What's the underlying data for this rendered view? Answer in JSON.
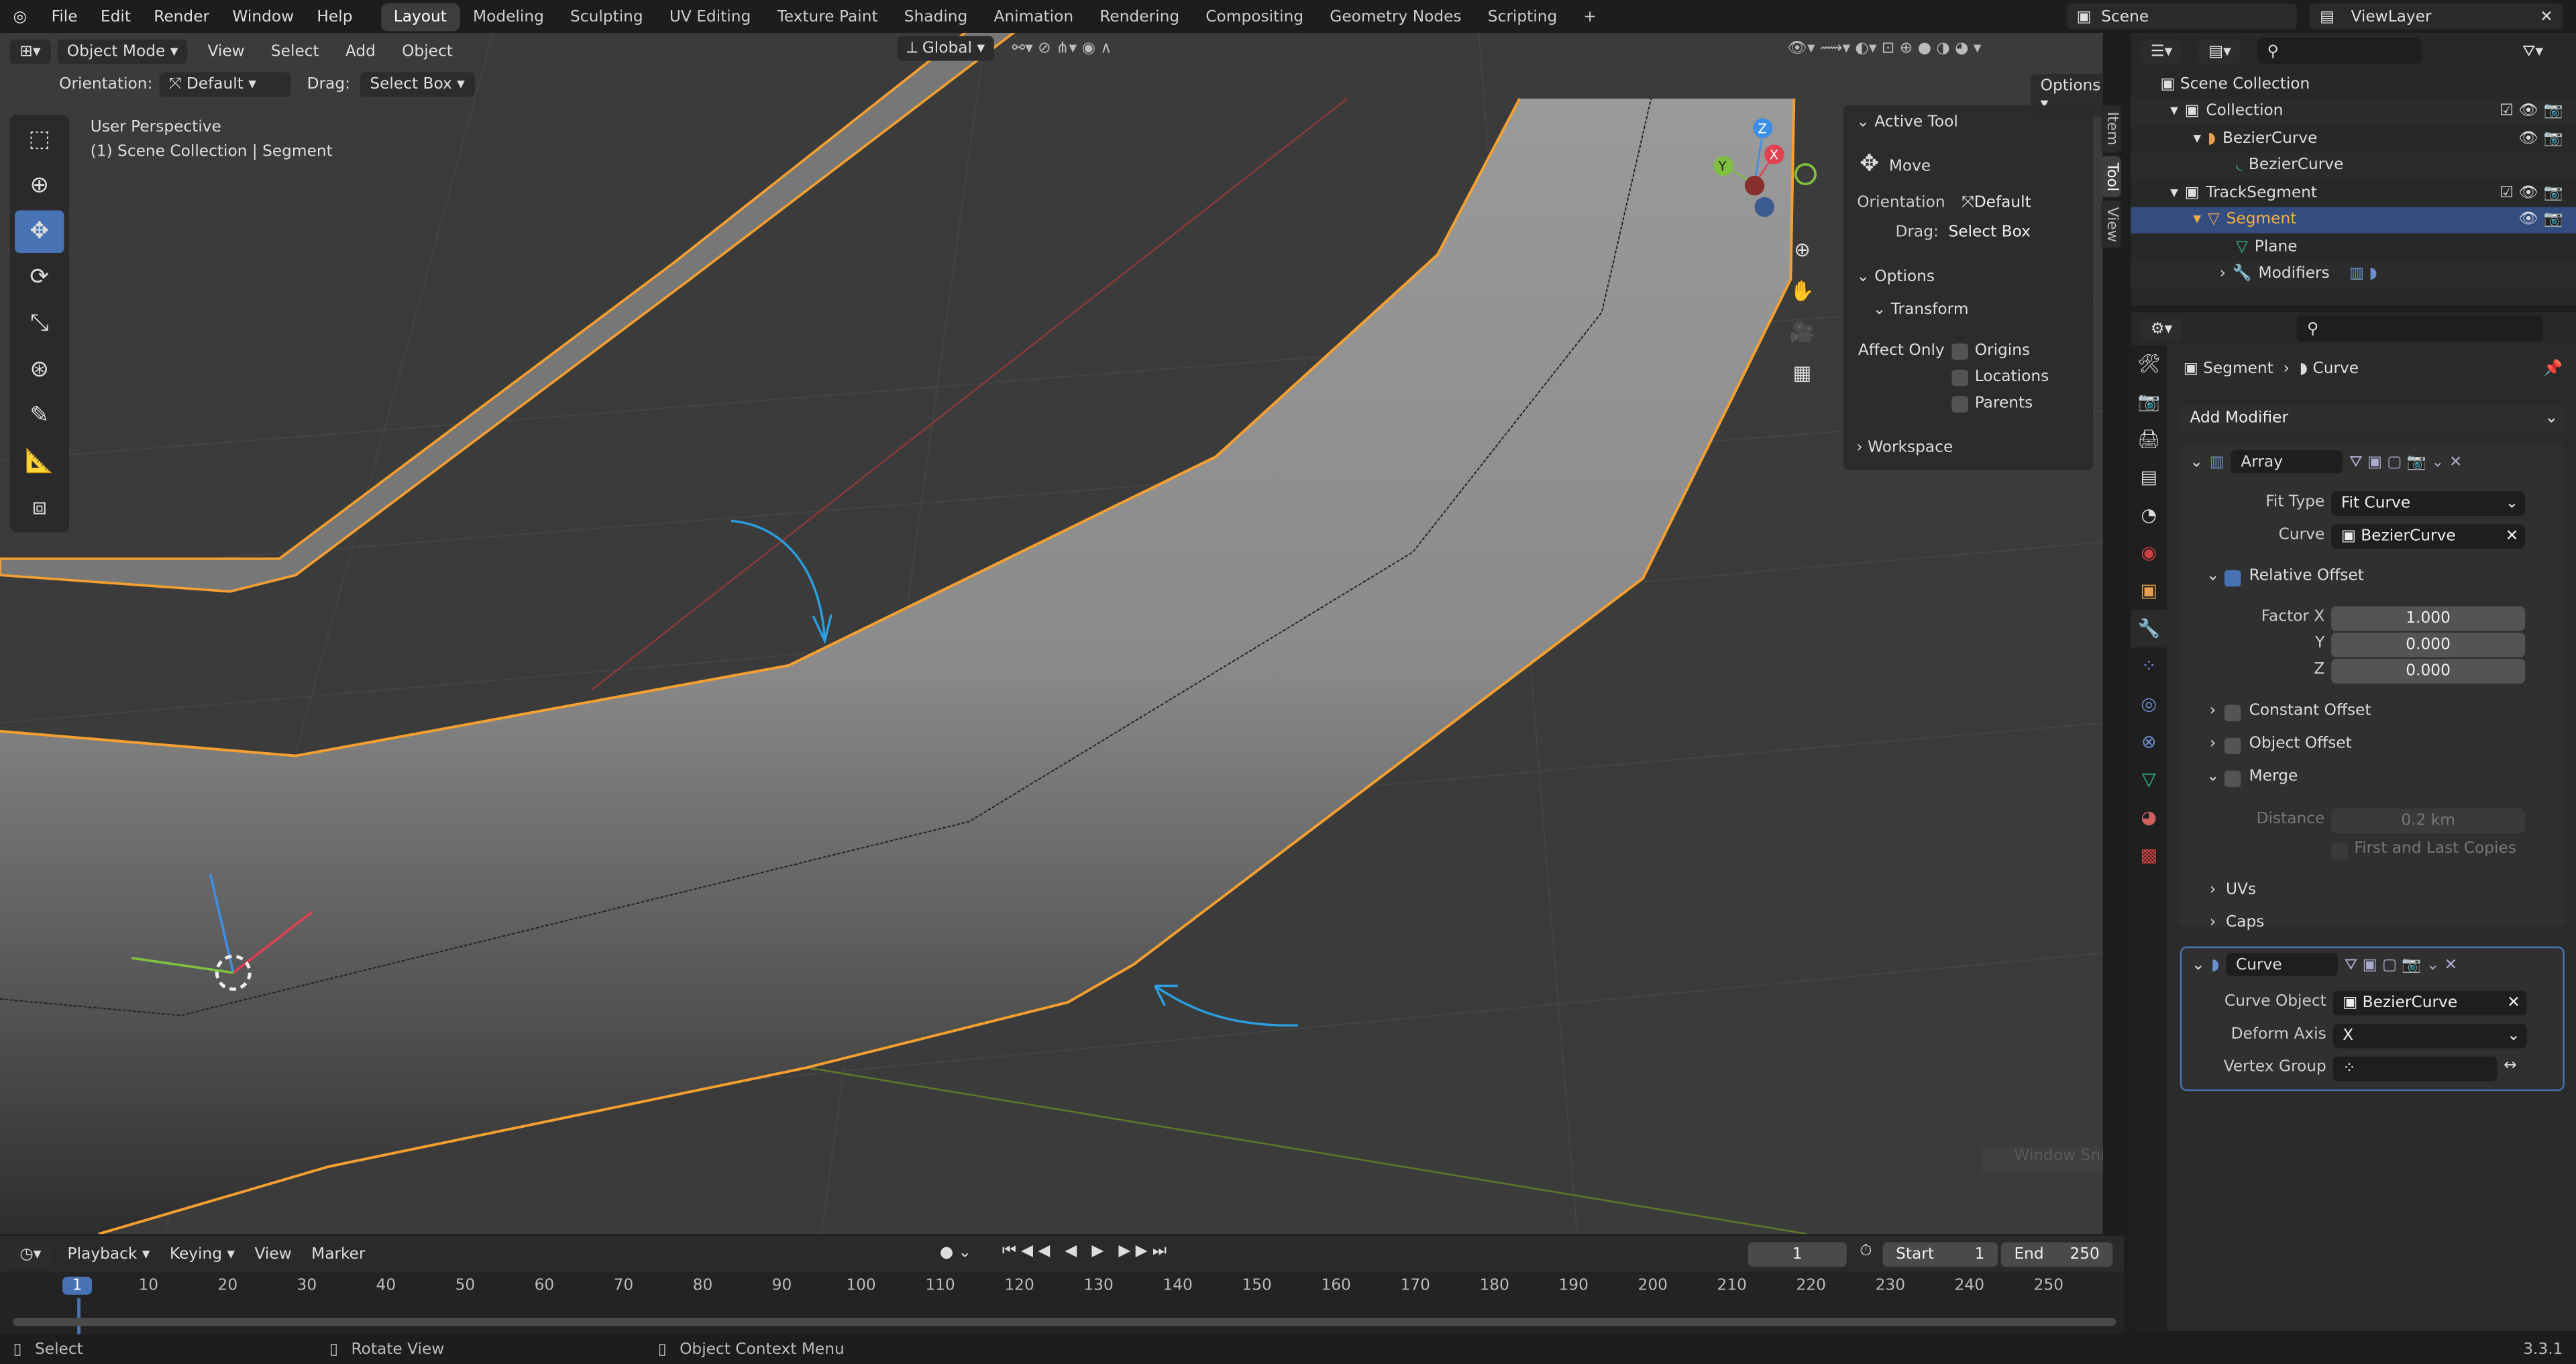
{
  "topbar": {
    "menus": [
      "File",
      "Edit",
      "Render",
      "Window",
      "Help"
    ],
    "workspaces": [
      "Layout",
      "Modeling",
      "Sculpting",
      "UV Editing",
      "Texture Paint",
      "Shading",
      "Animation",
      "Rendering",
      "Compositing",
      "Geometry Nodes",
      "Scripting"
    ],
    "active_workspace": "Layout",
    "add": "+",
    "scene": "Scene",
    "view_layer": "ViewLayer"
  },
  "viewport": {
    "mode": "Object Mode",
    "menus": [
      "View",
      "Select",
      "Add",
      "Object"
    ],
    "orientation_label": "Orientation:",
    "orientation": "Default",
    "drag_label": "Drag:",
    "drag": "Select Box",
    "transform_orientation": "Global",
    "options": "Options",
    "info_line1": "User Perspective",
    "info_line2": "(1) Scene Collection | Segment",
    "gizmo": {
      "x": "X",
      "y": "Y",
      "z": "Z"
    },
    "colors": {
      "selection_outline": "#f5a030",
      "annotation": "#2aa0e0",
      "x_axis": "#c84040",
      "y_axis": "#70a030"
    },
    "tooltip": "Window Snip"
  },
  "npanel": {
    "active_tool_title": "Active Tool",
    "tool": "Move",
    "orientation_label": "Orientation",
    "orientation": "Default",
    "drag_label": "Drag:",
    "drag": "Select Box",
    "options_title": "Options",
    "transform_title": "Transform",
    "affect_only": "Affect Only",
    "origins": "Origins",
    "locations": "Locations",
    "parents": "Parents",
    "workspace_title": "Workspace",
    "tabs": [
      "Item",
      "Tool",
      "View"
    ],
    "active_tab": "Tool"
  },
  "outliner": {
    "items": [
      {
        "label": "Scene Collection"
      },
      {
        "label": "Collection"
      },
      {
        "label": "BezierCurve"
      },
      {
        "label": "BezierCurve"
      },
      {
        "label": "TrackSegment"
      },
      {
        "label": "Segment"
      },
      {
        "label": "Plane"
      },
      {
        "label": "Modifiers"
      }
    ],
    "selected": "Segment"
  },
  "properties": {
    "breadcrumb_object": "Segment",
    "breadcrumb_data": "Curve",
    "add_modifier": "Add Modifier",
    "array": {
      "name": "Array",
      "fit_type_label": "Fit Type",
      "fit_type": "Fit Curve",
      "curve_label": "Curve",
      "curve": "BezierCurve",
      "relative_offset": "Relative Offset",
      "relative_offset_enabled": true,
      "factor_x_label": "Factor X",
      "factor_x": "1.000",
      "y_label": "Y",
      "factor_y": "0.000",
      "z_label": "Z",
      "factor_z": "0.000",
      "constant_offset": "Constant Offset",
      "object_offset": "Object Offset",
      "merge": "Merge",
      "distance_label": "Distance",
      "distance": "0.2 km",
      "first_last": "First and Last Copies",
      "uvs": "UVs",
      "caps": "Caps"
    },
    "curve": {
      "name": "Curve",
      "curve_object_label": "Curve Object",
      "curve_object": "BezierCurve",
      "deform_axis_label": "Deform Axis",
      "deform_axis": "X",
      "vertex_group_label": "Vertex Group",
      "vertex_group": ""
    }
  },
  "timeline": {
    "menus": [
      "Playback",
      "Keying",
      "View",
      "Marker"
    ],
    "current_frame": "1",
    "start_label": "Start",
    "start": "1",
    "end_label": "End",
    "end": "250",
    "ticks": [
      "1",
      "10",
      "20",
      "30",
      "40",
      "50",
      "60",
      "70",
      "80",
      "90",
      "100",
      "110",
      "120",
      "130",
      "140",
      "150",
      "160",
      "170",
      "180",
      "190",
      "200",
      "210",
      "220",
      "230",
      "240",
      "250"
    ]
  },
  "status": {
    "select": "Select",
    "rotate": "Rotate View",
    "context": "Object Context Menu",
    "version": "3.3.1"
  }
}
